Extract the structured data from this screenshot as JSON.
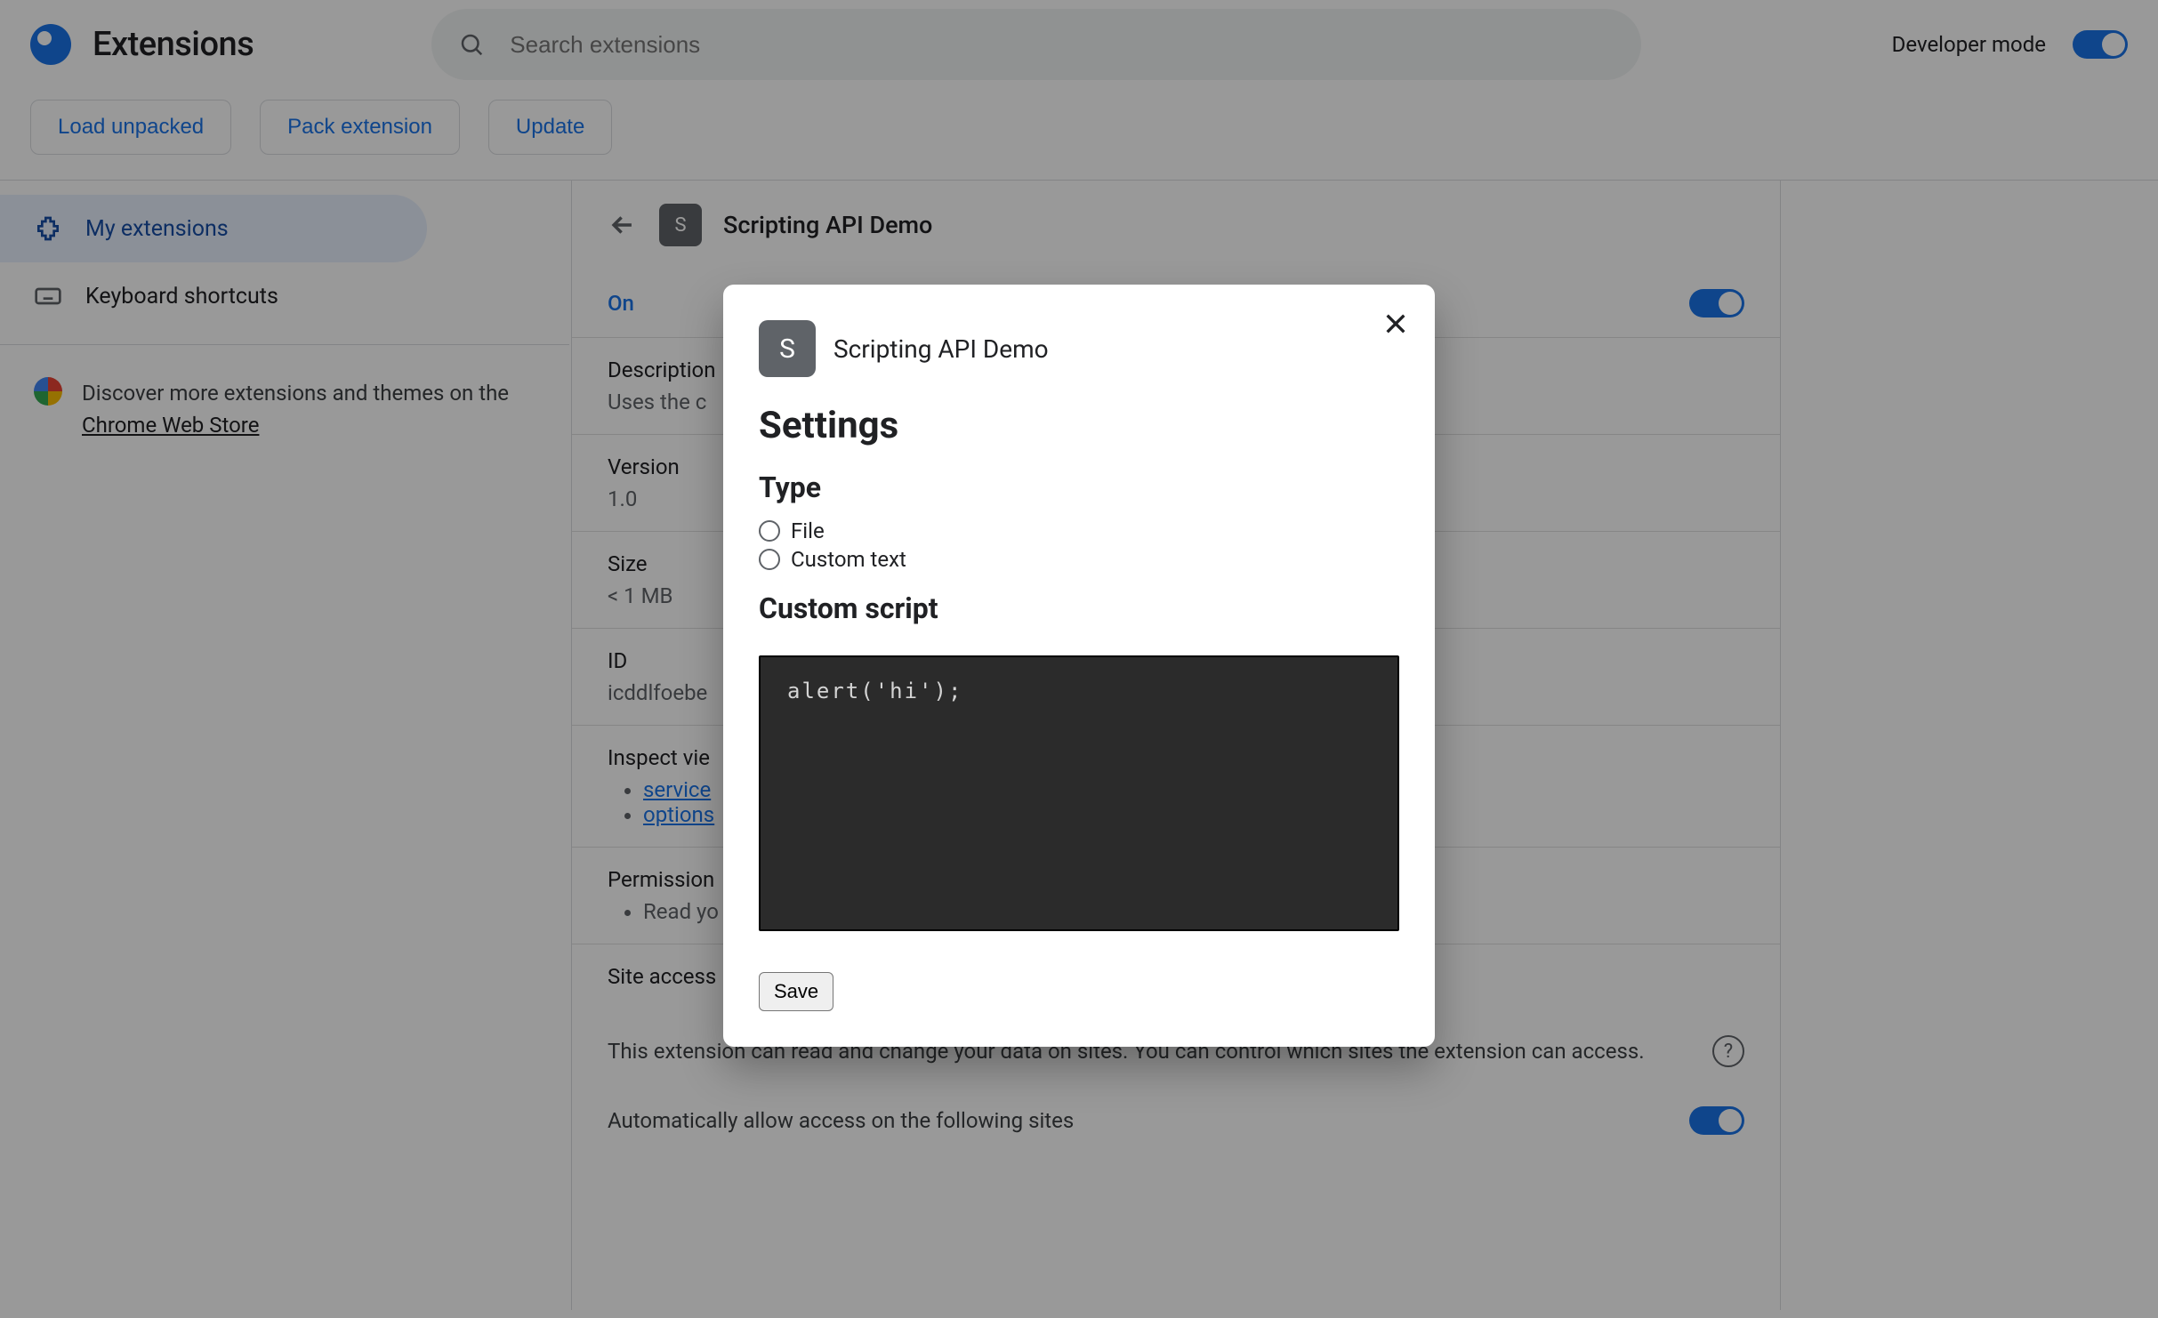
{
  "header": {
    "title": "Extensions",
    "search_placeholder": "Search extensions",
    "developer_mode_label": "Developer mode",
    "developer_mode_on": true
  },
  "actions": {
    "load_unpacked": "Load unpacked",
    "pack_extension": "Pack extension",
    "update": "Update"
  },
  "sidebar": {
    "items": [
      {
        "label": "My extensions",
        "active": true
      },
      {
        "label": "Keyboard shortcuts",
        "active": false
      }
    ],
    "promo_prefix": "Discover more extensions and themes on the ",
    "promo_link": "Chrome Web Store"
  },
  "details": {
    "avatar_letter": "S",
    "name": "Scripting API Demo",
    "status": "On",
    "enabled": true,
    "description_label": "Description",
    "description_value": "Uses the c",
    "version_label": "Version",
    "version_value": "1.0",
    "size_label": "Size",
    "size_value": "< 1 MB",
    "id_label": "ID",
    "id_value": "icddlfoebe",
    "inspect_label": "Inspect vie",
    "inspect_links": [
      "service",
      "options"
    ],
    "permissions_label": "Permission",
    "permissions_items": [
      "Read yo"
    ],
    "site_access_label": "Site access",
    "site_access_text": "This extension can read and change your data on sites. You can control which sites the extension can access.",
    "auto_allow_label": "Automatically allow access on the following sites"
  },
  "modal": {
    "avatar_letter": "S",
    "ext_name": "Scripting API Demo",
    "heading": "Settings",
    "type_heading": "Type",
    "type_options": [
      "File",
      "Custom text"
    ],
    "custom_script_heading": "Custom script",
    "script_value": "alert('hi');",
    "save_label": "Save"
  }
}
